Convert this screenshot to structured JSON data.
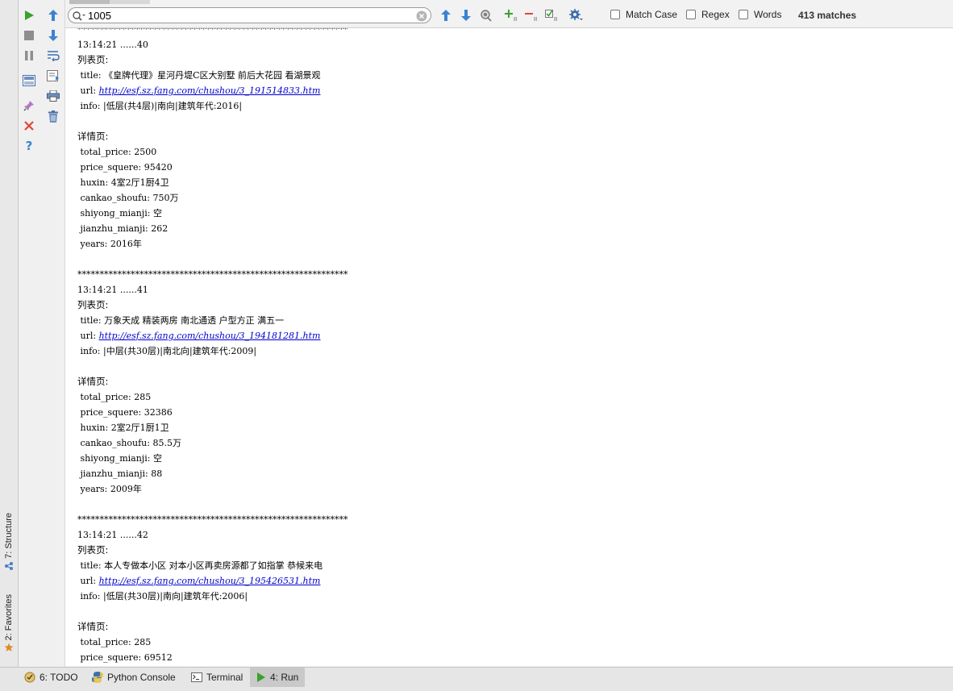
{
  "left_strip": {
    "structure_label": "7: Structure",
    "favorites_label": "2: Favorites"
  },
  "actions": [
    "run-icon",
    "stop-icon",
    "pause-icon",
    "layout-icon",
    "pin-icon",
    "close-icon",
    "help-icon",
    "up-arrow-icon",
    "down-arrow-icon",
    "soft-wrap-icon",
    "scroll-to-end-icon",
    "print-icon",
    "trash-icon"
  ],
  "search": {
    "value": "1005",
    "match_case_label": "Match Case",
    "regex_label": "Regex",
    "words_label": "Words",
    "match_count": "413 matches"
  },
  "console": {
    "separator": "*************************************************************",
    "records": [
      {
        "time": "13:14:21 ......40",
        "list_header": "列表页:",
        "title": "《皇牌代理》星河丹堤C区大别墅 前后大花园 看湖景观",
        "url": "http://esf.sz.fang.com/chushou/3_191514833.htm",
        "info": "|低层(共4层)|南向|建筑年代:2016|",
        "detail_header": "详情页:",
        "total_price": "2500",
        "price_squere": "95420",
        "huxin": "4室2厅1厨4卫",
        "cankao_shoufu": "750万",
        "shiyong_mianji": "空",
        "jianzhu_mianji": "262",
        "years": "2016年"
      },
      {
        "time": "13:14:21 ......41",
        "list_header": "列表页:",
        "title": "万象天成 精装两房 南北通透 户型方正 满五一",
        "url": "http://esf.sz.fang.com/chushou/3_194181281.htm",
        "info": "|中层(共30层)|南北向|建筑年代:2009|",
        "detail_header": "详情页:",
        "total_price": "285",
        "price_squere": "32386",
        "huxin": "2室2厅1厨1卫",
        "cankao_shoufu": "85.5万",
        "shiyong_mianji": "空",
        "jianzhu_mianji": "88",
        "years": "2009年"
      },
      {
        "time": "13:14:21 ......42",
        "list_header": "列表页:",
        "title": "本人专做本小区 对本小区再卖房源都了如指掌 恭候来电",
        "url": "http://esf.sz.fang.com/chushou/3_195426531.htm",
        "info": "|低层(共30层)|南向|建筑年代:2006|",
        "detail_header": "详情页:",
        "total_price": "285",
        "price_squere": "69512"
      }
    ]
  },
  "bottom_tabs": [
    {
      "label": "6: TODO",
      "icon": "todo-icon"
    },
    {
      "label": "Python Console",
      "icon": "python-icon"
    },
    {
      "label": "Terminal",
      "icon": "terminal-icon"
    },
    {
      "label": "4: Run",
      "icon": "run-icon"
    }
  ]
}
